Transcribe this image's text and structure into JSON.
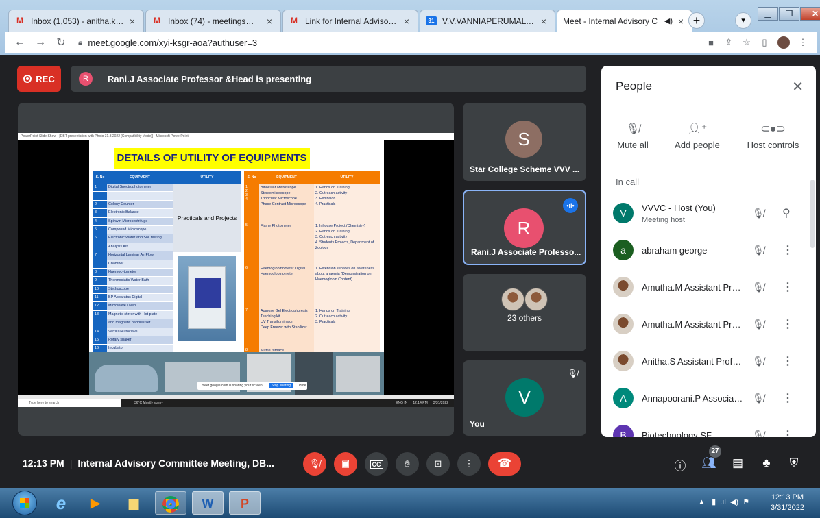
{
  "browser": {
    "tabs": [
      {
        "label": "Inbox (1,053) - anitha.karuppa",
        "icon": "gmail-icon"
      },
      {
        "label": "Inbox (74) - meetings@vvvcoll",
        "icon": "gmail-icon"
      },
      {
        "label": "Link for Internal Advisory Com",
        "icon": "gmail-icon"
      },
      {
        "label": "V.V.VANNIAPERUMAL COLLEG",
        "icon": "calendar-icon",
        "fav_text": "31"
      },
      {
        "label": "Meet - Internal Advisory C",
        "icon": "meet-icon",
        "active": true
      }
    ],
    "url": "meet.google.com/xyi-ksgr-aoa?authuser=3"
  },
  "meet": {
    "rec_label": "REC",
    "presenter_initial": "R",
    "presenting_text": "Rani.J Associate Professor &Head is presenting",
    "slide": {
      "app_title": "PowerPoint Slide Show - [DBT presentation with Photo 31.3.2022 [Compatibility Mode]] - Microsoft PowerPoint",
      "heading": "DETAILS OF UTILITY OF EQUIPMENTS",
      "table1_headers": [
        "S. No",
        "EQUIPMENT",
        "UTILITY"
      ],
      "table1_rows": [
        {
          "n": "1",
          "e": "Digital Spectrophotometer"
        },
        {
          "n": "",
          "e": ""
        },
        {
          "n": "2",
          "e": "Colony Counter"
        },
        {
          "n": "3",
          "e": "Electronic Balance"
        },
        {
          "n": "4",
          "e": "Spinwin Microcentrifuge"
        },
        {
          "n": "5",
          "e": "Compound Microscope"
        },
        {
          "n": "6",
          "e": "Electronic Water and Soil testing"
        },
        {
          "n": "",
          "e": "Analysis Kit"
        },
        {
          "n": "7",
          "e": "Horizontal Laminar Air Flow"
        },
        {
          "n": "",
          "e": "Chamber"
        },
        {
          "n": "8",
          "e": "Haemocytometer"
        },
        {
          "n": "9",
          "e": "Thermostatic Water Bath"
        },
        {
          "n": "10",
          "e": "Stethoscope"
        },
        {
          "n": "11",
          "e": "BP Apparatus Digital"
        },
        {
          "n": "12",
          "e": "Microwave Oven"
        },
        {
          "n": "13",
          "e": "Magnetic stirrer with Hot plate"
        },
        {
          "n": "",
          "e": "and magnetic paddles set"
        },
        {
          "n": "14",
          "e": "Vertical Autoclave"
        },
        {
          "n": "15",
          "e": "Rotary shaker"
        },
        {
          "n": "16",
          "e": "Incubator"
        },
        {
          "n": "17",
          "e": "Digital Colorimeter"
        },
        {
          "n": "18",
          "e": "Compound microscopes"
        },
        {
          "n": "19",
          "e": "Magnetic stirrer"
        },
        {
          "n": "20",
          "e": "Vortex mixer"
        }
      ],
      "table1_utility": "Practicals and Projects",
      "table2_headers": [
        "S. No",
        "EQUIPMENT",
        "UTILITY"
      ],
      "table2_blocks": [
        {
          "n": "1\n2\n3\n4",
          "e": "Binocular Microscope\nStereomicroscope\nTrinocular Microscope\nPhase Contrast Microscope",
          "u": "1. Hands on Training\n2. Outreach activity\n3. Exhibition\n4. Practicals"
        },
        {
          "n": "5",
          "e": "Flame Photometer",
          "u": "1. Inhouse Project (Chemistry)\n2. Hands on Training\n3. Outreach activity\n4. Students Projects, Department of Zoology"
        },
        {
          "n": "6",
          "e": "Haemoglobinometer Digital Haemoglobinometer",
          "u": "1. Extension services on awareness about anaemia (Demonstration on Haemoglobin Content)"
        },
        {
          "n": "7",
          "e": "Agarose Gel Electrophoresis Teaching kit\nUV Transilluminator\nDeep Freezer with Stabilizer",
          "u": "1. Hands on Training\n2. Outreach activity\n3. Practicals"
        },
        {
          "n": "8",
          "e": "Muffle furnace",
          "u": ""
        }
      ],
      "share_note": "meet.google.com is sharing your screen.",
      "stop_sharing": "Stop sharing",
      "hide": "Hide",
      "taskbar_search": "Type here to search",
      "weather": "36°C Mostly sunny",
      "win_lang": "ENG IN",
      "win_time": "12:14 PM",
      "win_date": "3/31/2022"
    },
    "tiles": [
      {
        "initial": "S",
        "name": "Star College Scheme VVV ..."
      },
      {
        "initial": "R",
        "name": "Rani.J Associate Professo..."
      },
      {
        "name": "23 others"
      },
      {
        "initial": "V",
        "name": "You"
      }
    ],
    "people": {
      "title": "People",
      "actions": [
        "Mute all",
        "Add people",
        "Host controls"
      ],
      "in_call": "In call",
      "list": [
        {
          "initial": "V",
          "name": "VVVC - Host (You)",
          "sub": "Meeting host",
          "color": "#00796b"
        },
        {
          "initial": "a",
          "name": "abraham george",
          "color": "#1b5e20"
        },
        {
          "initial": "",
          "name": "Amutha.M Assistant Prof...",
          "photo": true
        },
        {
          "initial": "",
          "name": "Amutha.M Assistant Prof...",
          "photo": true
        },
        {
          "initial": "",
          "name": "Anitha.S Assistant Profes...",
          "photo": true
        },
        {
          "initial": "A",
          "name": "Annapoorani.P Associate ...",
          "color": "#00897b"
        },
        {
          "initial": "B",
          "name": "Biotechnology SF",
          "color": "#5e35b1"
        }
      ]
    },
    "bottom": {
      "time": "12:13 PM",
      "meeting_title": "Internal Advisory Committee Meeting, DB...",
      "participant_count": "27"
    }
  },
  "taskbar": {
    "time": "12:13 PM",
    "date": "3/31/2022"
  }
}
